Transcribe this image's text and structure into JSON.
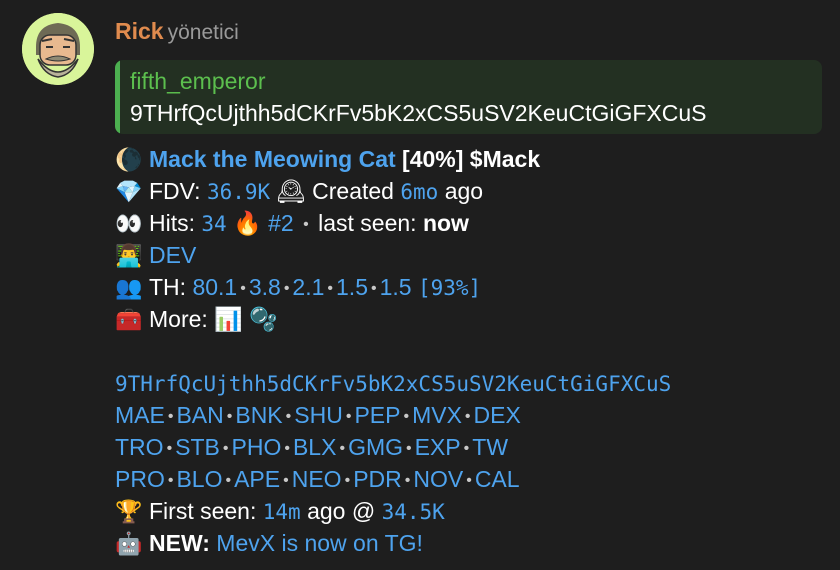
{
  "message": {
    "author": "Rick",
    "role": "yönetici",
    "reply": {
      "name": "fifth_emperor",
      "text": "9THrfQcUjthh5dCKrFv5bK2xCS5uSV2KeuCtGiGFXCuS"
    },
    "token": {
      "icon": "🌘",
      "name": "Mack the Meowing Cat",
      "percent": "[40%]",
      "ticker": "$Mack"
    },
    "fdv": {
      "icon": "💎",
      "label": "FDV:",
      "value": "36.9K",
      "created_icon": "🕰",
      "created_label": "Created",
      "created_value": "6mo",
      "created_suffix": "ago"
    },
    "hits": {
      "icon": "👀",
      "label": "Hits:",
      "value": "34",
      "fire_icon": "🔥",
      "rank": "#2",
      "sep": "•",
      "last_seen_label": "last seen:",
      "last_seen_value": "now"
    },
    "dev": {
      "icon": "👨‍💻",
      "label": "DEV"
    },
    "th": {
      "icon": "👥",
      "label": "TH:",
      "values": [
        "80.1",
        "3.8",
        "2.1",
        "1.5",
        "1.5"
      ],
      "total": "[93%]"
    },
    "more": {
      "icon": "🧰",
      "label": "More:",
      "chart_icon": "📊",
      "bubbles_icon": "🫧"
    },
    "contract": "9THrfQcUjthh5dCKrFv5bK2xCS5uSV2KeuCtGiGFXCuS",
    "link_rows": [
      [
        "MAE",
        "BAN",
        "BNK",
        "SHU",
        "PEP",
        "MVX",
        "DEX"
      ],
      [
        "TRO",
        "STB",
        "PHO",
        "BLX",
        "GMG",
        "EXP",
        "TW"
      ],
      [
        "PRO",
        "BLO",
        "APE",
        "NEO",
        "PDR",
        "NOV",
        "CAL"
      ]
    ],
    "first_seen": {
      "icon": "🏆",
      "label": "First seen:",
      "time": "14m",
      "middle": "ago @",
      "value": "34.5K"
    },
    "news": {
      "icon": "🤖",
      "label": "NEW:",
      "text": "MevX is now on TG!"
    }
  }
}
